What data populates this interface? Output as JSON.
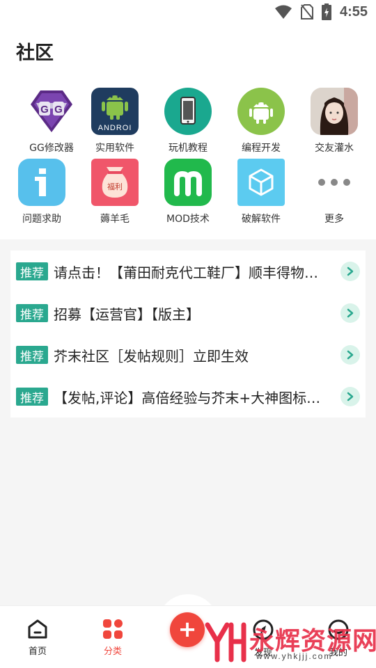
{
  "status_bar": {
    "time": "4:55"
  },
  "page": {
    "title": "社区"
  },
  "categories": [
    {
      "label": "GG修改器",
      "icon": "gg-logo-icon"
    },
    {
      "label": "实用软件",
      "icon": "android-icon"
    },
    {
      "label": "玩机教程",
      "icon": "phone-icon"
    },
    {
      "label": "编程开发",
      "icon": "android-robot-icon"
    },
    {
      "label": "交友灌水",
      "icon": "girl-avatar-icon"
    },
    {
      "label": "问题求助",
      "icon": "info-icon"
    },
    {
      "label": "薅羊毛",
      "icon": "lucky-bag-icon",
      "badge": "福利"
    },
    {
      "label": "MOD技术",
      "icon": "mod-m-icon"
    },
    {
      "label": "破解软件",
      "icon": "cube-icon"
    },
    {
      "label": "更多",
      "icon": "more-dots-icon"
    }
  ],
  "recommended": {
    "badge": "推荐",
    "items": [
      {
        "title": "请点击！【莆田耐克代工鞋厂】顺丰得物验货版"
      },
      {
        "title": "招募【运营官】【版主】"
      },
      {
        "title": "芥末社区［发帖规则］立即生效"
      },
      {
        "title": "【发帖,评论】高倍经验与芥末+大神图标(经验翻倍活动)"
      }
    ]
  },
  "bottom_nav": {
    "items": [
      {
        "label": "首页",
        "icon": "home-icon",
        "active": false
      },
      {
        "label": "分类",
        "icon": "category-grid-icon",
        "active": true
      },
      {
        "label": "发现",
        "icon": "compass-icon",
        "active": false
      },
      {
        "label": "我的",
        "icon": "profile-face-icon",
        "active": false
      }
    ],
    "fab_icon": "plus-icon"
  },
  "watermark": {
    "text": "永辉资源网",
    "url": "www.yhkjjj.com"
  },
  "colors": {
    "accent_red": "#f0463c",
    "badge_green": "#2aa88f",
    "arrow_bg": "#d9f3ea"
  }
}
